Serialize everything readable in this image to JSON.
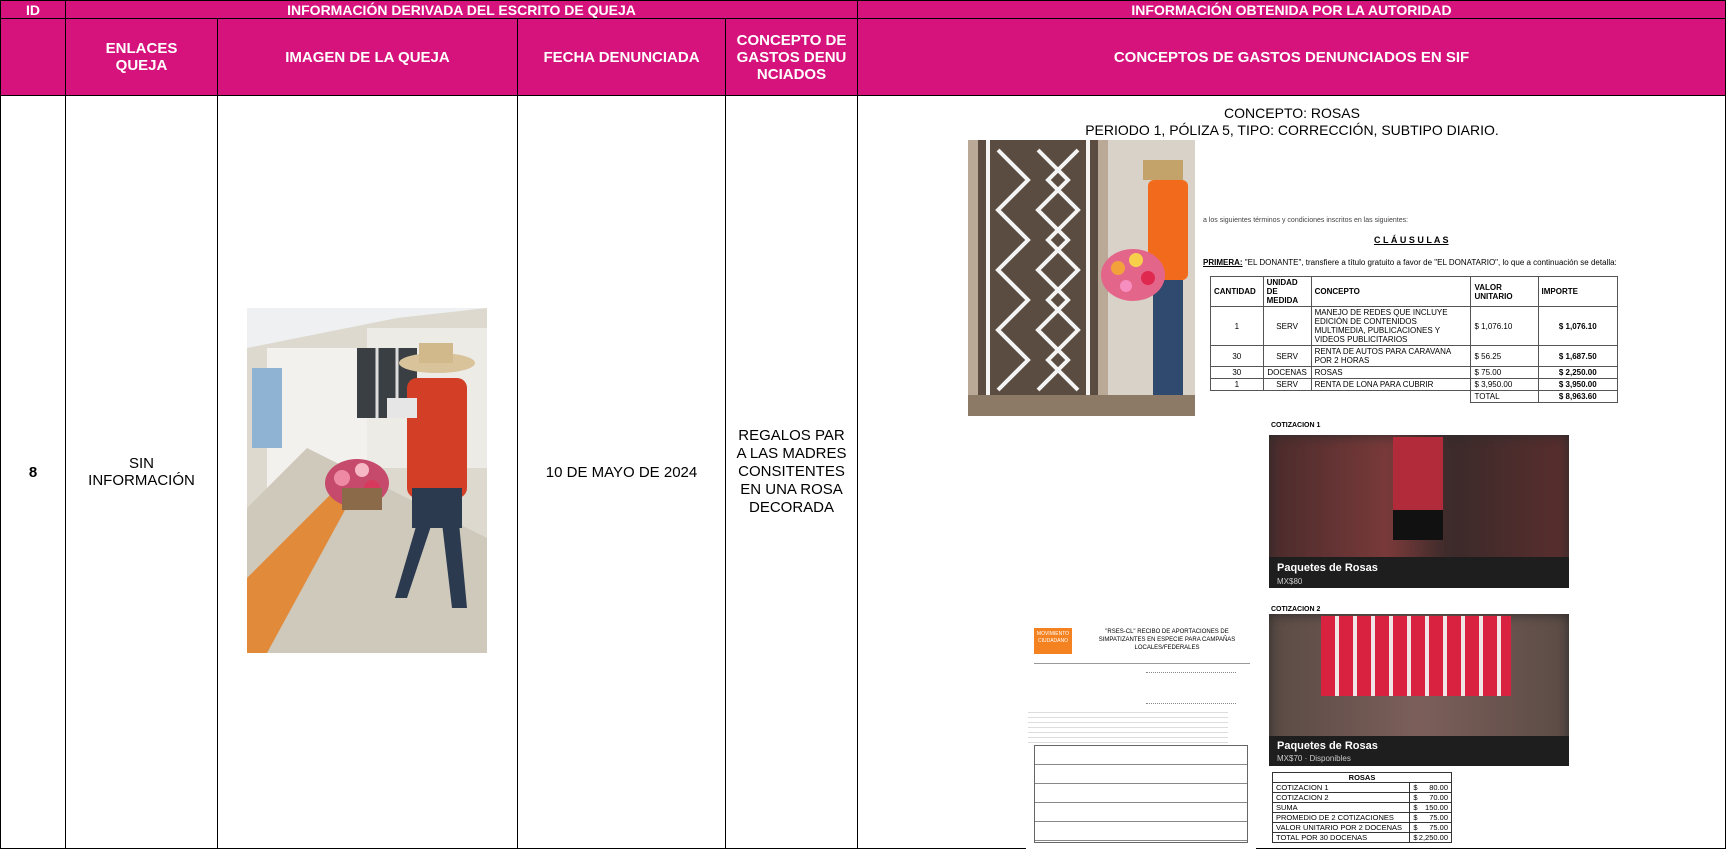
{
  "header": {
    "id": "ID",
    "group_left": "INFORMACIÓN DERIVADA DEL ESCRITO DE QUEJA",
    "group_right": "INFORMACIÓN OBTENIDA POR LA AUTORIDAD",
    "col_links": "ENLACES QUEJA",
    "col_image": "IMAGEN DE LA QUEJA",
    "col_date": "FECHA DENUNCIADA",
    "col_concept": "CONCEPTO DE GASTOS DENUNCIADOS",
    "col_sif": "CONCEPTOS DE GASTOS DENUNCIADOS EN SIF"
  },
  "row": {
    "id": "8",
    "links": "SIN INFORMACIÓN",
    "date": "10 DE MAYO DE 2024",
    "concept": "REGALOS PARA LAS MADRES CONSITENTES EN UNA ROSA DECORADA"
  },
  "sif": {
    "concept_line": "CONCEPTO: ROSAS",
    "period_line": "PERIODO 1, PÓLIZA 5, TIPO: CORRECCIÓN, SUBTIPO DIARIO.",
    "contract": {
      "cut_line": "a los siguientes términos y condiciones inscritos en las siguientes:",
      "clauses_title": "C L Á U S U L A S",
      "first_label": "PRIMERA:",
      "first_text": "\"EL DONANTE\", transfiere a título gratuito a favor de \"EL DONATARIO\", lo que a continuación se detalla:",
      "headers": [
        "CANTIDAD",
        "UNIDAD DE MEDIDA",
        "CONCEPTO",
        "VALOR UNITARIO",
        "IMPORTE"
      ],
      "rows": [
        {
          "qty": "1",
          "unit": "SERV",
          "concept": "MANEJO DE REDES QUE INCLUYE EDICIÓN DE CONTENIDOS MULTIMEDIA, PUBLICACIONES Y VIDEOS PUBLICITARIOS",
          "unit_value": "$ 1,076.10",
          "amount": "$ 1,076.10"
        },
        {
          "qty": "30",
          "unit": "SERV",
          "concept": "RENTA DE AUTOS PARA CARAVANA POR 2 HORAS",
          "unit_value": "$ 56.25",
          "amount": "$ 1,687.50"
        },
        {
          "qty": "30",
          "unit": "DOCENAS",
          "concept": "ROSAS",
          "unit_value": "$ 75.00",
          "amount": "$ 2,250.00"
        },
        {
          "qty": "1",
          "unit": "SERV",
          "concept": "RENTA DE LONA PARA CUBRIR",
          "unit_value": "$ 3,950.00",
          "amount": "$ 3,950.00"
        }
      ],
      "total_label": "TOTAL",
      "total_value": "$ 8,963.60"
    },
    "quote1": {
      "caption": "COTIZACION 1",
      "title": "Paquetes de Rosas",
      "price": "MX$80"
    },
    "quote2": {
      "caption": "COTIZACION 2",
      "title": "Paquetes de Rosas",
      "price": "MX$70 · Disponibles"
    },
    "receipt": {
      "title": "\"RSES-CL\" RECIBO DE APORTACIONES DE SIMPATIZANTES EN ESPECIE PARA CAMPAÑAS LOCALES/FEDERALES",
      "logo_text": "MOVIMIENTO CIUDADANO"
    },
    "summary": {
      "title": "ROSAS",
      "rows": [
        {
          "label": "COTIZACION 1",
          "cur": "$",
          "value": "80.00"
        },
        {
          "label": "COTIZACION 2",
          "cur": "$",
          "value": "70.00"
        },
        {
          "label": "SUMA",
          "cur": "$",
          "value": "150.00"
        },
        {
          "label": "PROMEDIO DE 2 COTIZACIONES",
          "cur": "$",
          "value": "75.00"
        },
        {
          "label": "VALOR UNITARIO POR 2 DOCENAS",
          "cur": "$",
          "value": "75.00"
        },
        {
          "label": "TOTAL POR 30 DOCENAS",
          "cur": "$",
          "value": "2,250.00"
        }
      ]
    }
  },
  "colors": {
    "header_bg": "#d6127d",
    "header_text": "#ffffff",
    "mc_orange": "#f58220"
  }
}
